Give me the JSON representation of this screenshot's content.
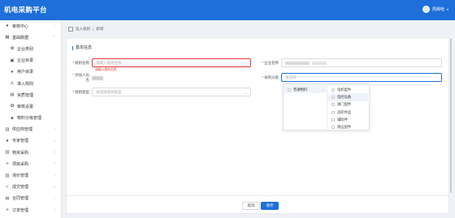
{
  "app": {
    "title": "机电采购平台",
    "user_name": "周辉哈"
  },
  "sidebar": {
    "items": [
      {
        "label": "审核中心",
        "icon": "person-icon",
        "sub": false
      },
      {
        "label": "基础数据",
        "icon": "grid-icon",
        "sub": false
      },
      {
        "label": "企业类别",
        "icon": "gear-icon",
        "sub": true
      },
      {
        "label": "企业目录",
        "icon": "building-icon",
        "sub": true
      },
      {
        "label": "用户目录",
        "icon": "person-icon",
        "sub": true
      },
      {
        "label": "准入规则",
        "icon": "rule-icon",
        "sub": true
      },
      {
        "label": "资质管理",
        "icon": "doc-icon",
        "sub": true
      },
      {
        "label": "审核设置",
        "icon": "gear-icon",
        "sub": true
      },
      {
        "label": "物料分级管理",
        "icon": "tag-icon",
        "sub": true
      },
      {
        "label": "供应商管理",
        "icon": "store-icon",
        "sub": false
      },
      {
        "label": "专家管理",
        "icon": "person-icon",
        "sub": false
      },
      {
        "label": "物资采购",
        "icon": "box-icon",
        "sub": false
      },
      {
        "label": "项目采购",
        "icon": "list-icon",
        "sub": false
      },
      {
        "label": "询价管理",
        "icon": "chart-icon",
        "sub": false
      },
      {
        "label": "成交管理",
        "icon": "check-icon",
        "sub": false
      },
      {
        "label": "合同管理",
        "icon": "doc-icon",
        "sub": false
      },
      {
        "label": "订单管理",
        "icon": "list-icon",
        "sub": false
      }
    ]
  },
  "breadcrumb": {
    "parent": "准入规则",
    "current": "新增"
  },
  "form": {
    "section_title": "基本信息",
    "rule_name": {
      "label": "规则名称",
      "placeholder": "请输入规则名称",
      "error": "请输入规则名称"
    },
    "company_name": {
      "label": "企业名称"
    },
    "creator": {
      "label": "添加人员名"
    },
    "purchase_category": {
      "label": "采购分类",
      "placeholder": "请选择"
    },
    "rule_type": {
      "label": "规则类型",
      "placeholder": "请选择规则类型"
    }
  },
  "dropdown": {
    "left": [
      {
        "label": "普通物料",
        "selected": true
      }
    ],
    "right": [
      {
        "label": "电机配件",
        "selected": false
      },
      {
        "label": "电控设备",
        "selected": true
      },
      {
        "label": "阀门配件",
        "selected": false
      },
      {
        "label": "齿轮件品",
        "selected": false
      },
      {
        "label": "辅助件",
        "selected": false
      },
      {
        "label": "液压配件",
        "selected": false
      }
    ]
  },
  "buttons": {
    "cancel": "取消",
    "save": "保存"
  },
  "colors": {
    "primary": "#1e6fd9",
    "error": "#e53935"
  }
}
